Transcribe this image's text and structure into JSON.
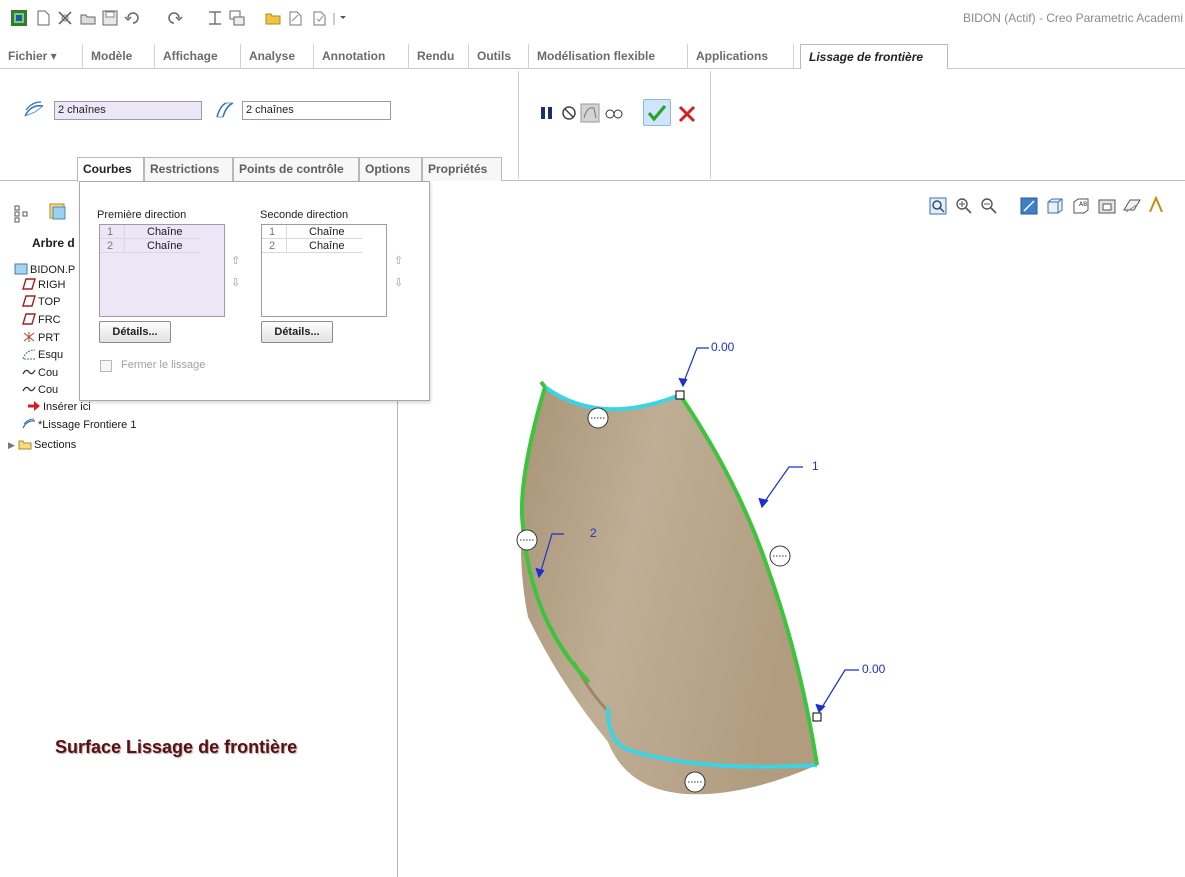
{
  "window": {
    "title": "BIDON (Actif) - Creo Parametric Academi"
  },
  "quick_access": {
    "icons": [
      "app-icon",
      "new-icon",
      "regenerate-icon",
      "open-icon",
      "save-icon",
      "undo-icon",
      "redo-icon",
      "windows-icon",
      "close-window-icon",
      "folder-icon",
      "pan-icon",
      "spin-icon",
      "customize-icon"
    ]
  },
  "ribbon_tabs": [
    {
      "label": "Fichier ▾"
    },
    {
      "label": "Modèle"
    },
    {
      "label": "Affichage"
    },
    {
      "label": "Analyse"
    },
    {
      "label": "Annotation"
    },
    {
      "label": "Rendu"
    },
    {
      "label": "Outils"
    },
    {
      "label": "Modélisation flexible"
    },
    {
      "label": "Applications"
    },
    {
      "label": "Lissage de frontière"
    }
  ],
  "ribbon": {
    "first_chain_value": "2 chaînes",
    "second_chain_value": "2 chaînes",
    "controls": [
      "pause-icon",
      "no-preview-icon",
      "preview-icon",
      "verify-icon",
      "confirm-icon",
      "cancel-icon"
    ]
  },
  "sub_tabs": [
    {
      "label": "Courbes"
    },
    {
      "label": "Restrictions"
    },
    {
      "label": "Points de contrôle"
    },
    {
      "label": "Options"
    },
    {
      "label": "Propriétés"
    }
  ],
  "courbes_panel": {
    "first_direction_label": "Première direction",
    "second_direction_label": "Seconde direction",
    "first_direction_rows": [
      {
        "index": "1",
        "name": "Chaîne"
      },
      {
        "index": "2",
        "name": "Chaîne"
      }
    ],
    "second_direction_rows": [
      {
        "index": "1",
        "name": "Chaîne"
      },
      {
        "index": "2",
        "name": "Chaîne"
      }
    ],
    "details_label": "Détails...",
    "close_blend_label": "Fermer le lissage"
  },
  "model_tree": {
    "title": "Arbre d",
    "items": [
      {
        "label": "BIDON.P",
        "icon": "part-icon"
      },
      {
        "label": "RIGH",
        "icon": "datum-plane-icon"
      },
      {
        "label": "TOP",
        "icon": "datum-plane-icon"
      },
      {
        "label": "FRC",
        "icon": "datum-plane-icon"
      },
      {
        "label": "PRT",
        "icon": "coordinate-system-icon"
      },
      {
        "label": "Esqu",
        "icon": "sketch-icon"
      },
      {
        "label": "Cou",
        "icon": "curve-icon"
      },
      {
        "label": "Cou",
        "icon": "curve-icon"
      },
      {
        "label": "Insérer ici",
        "icon": "insert-here-icon"
      },
      {
        "label": "*Lissage Frontiere 1",
        "icon": "boundary-blend-icon"
      },
      {
        "label": "Sections",
        "icon": "folder-icon"
      }
    ]
  },
  "graphics": {
    "toolbar": [
      "refit-icon",
      "zoom-in-icon",
      "zoom-out-icon",
      "repaint-icon",
      "display-style-icon",
      "saved-orientations-icon",
      "view-manager-icon",
      "perspective-icon",
      "annotation-display-icon"
    ],
    "dimensions": [
      {
        "label": "0.00"
      },
      {
        "label": "1"
      },
      {
        "label": "2"
      },
      {
        "label": "0.00"
      }
    ],
    "colors": {
      "surface": "#bda98f",
      "boundary_chain_1": "#3cc43c",
      "boundary_chain_2": "#3ad4e4",
      "dimension": "#1c2fd0"
    }
  },
  "caption": "Surface Lissage de frontière"
}
